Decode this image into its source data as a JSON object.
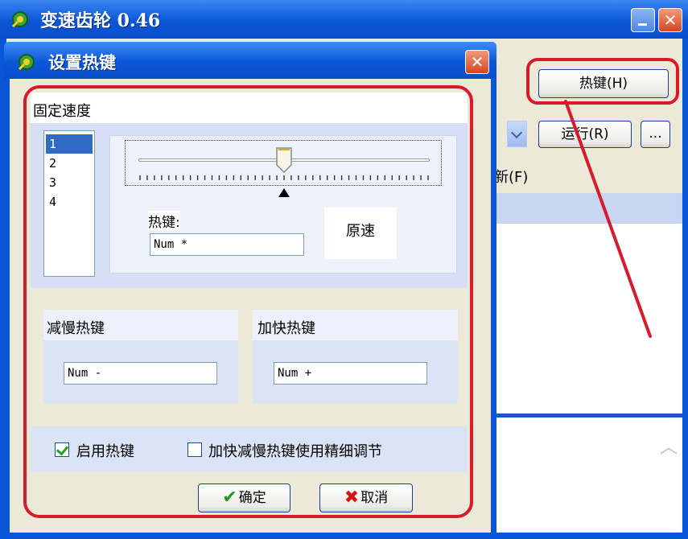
{
  "main_window": {
    "title": "变速齿轮 0.46",
    "hotkey_button": "热键(H)",
    "run_button": "运行(R)",
    "more_button": "...",
    "refresh_menu": "新(F)",
    "minimize_icon": "minimize-icon",
    "close_icon": "close-icon",
    "scroll_icon": "chevron-up-icon"
  },
  "dialog": {
    "title": "设置热键",
    "close_icon": "close-icon",
    "fixed_speed": {
      "label": "固定速度",
      "speed_list": [
        "1",
        "2",
        "3",
        "4"
      ],
      "selected_speed": "1",
      "slider_level": 0.5,
      "hotkey_label": "热键:",
      "hotkey_value": "Num *",
      "original_speed_button": "原速"
    },
    "slow_down": {
      "label": "减慢热键",
      "value": "Num -"
    },
    "speed_up": {
      "label": "加快热键",
      "value": "Num +"
    },
    "enable_hotkey": {
      "label": "启用热键",
      "checked": true
    },
    "fine_adjust": {
      "label": "加快减慢热键使用精细调节",
      "checked": false
    },
    "ok_button": "确定",
    "cancel_button": "取消"
  },
  "colors": {
    "titlebar_blue": "#0a55d8",
    "annotation_red": "#d81a2a",
    "panel_bg": "#ece9d8",
    "group_bg": "#d6dff5"
  }
}
